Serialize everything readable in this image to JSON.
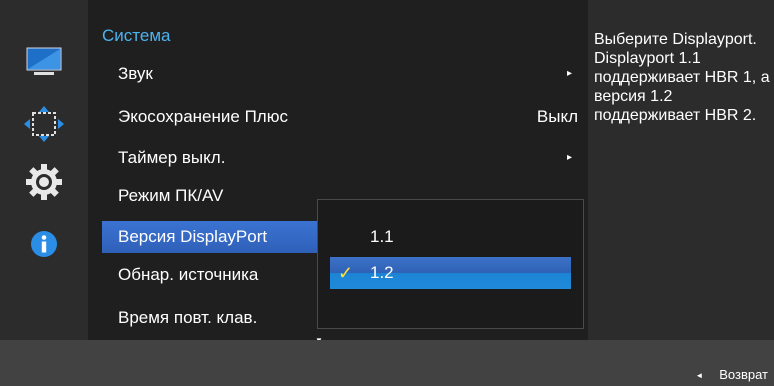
{
  "sidebar": {
    "icons": [
      "monitor-icon",
      "resize-arrows-icon",
      "gear-icon",
      "info-icon"
    ],
    "accent_color": "#2a8ee6"
  },
  "main": {
    "section_title": "Система",
    "items": [
      {
        "label": "Звук",
        "value": "",
        "arrow": "▸"
      },
      {
        "label": "Экосохранение Плюс",
        "value": "Выкл",
        "arrow": ""
      },
      {
        "label": "Таймер выкл.",
        "value": "",
        "arrow": "▸"
      },
      {
        "label": "Режим ПК/AV",
        "value": "",
        "arrow": ""
      },
      {
        "label": "Версия DisplayPort",
        "value": "",
        "arrow": ""
      },
      {
        "label": "Обнар. источника",
        "value": "",
        "arrow": ""
      },
      {
        "label": "Время повт. клав.",
        "value": "",
        "arrow": ""
      }
    ],
    "scroll_indicator": "▼"
  },
  "submenu": {
    "options": [
      {
        "label": "1.1",
        "checked": false
      },
      {
        "label": "1.2",
        "checked": true
      }
    ],
    "check_mark": "✓"
  },
  "help": {
    "text": "Выберите Displayport. Displayport 1.1 поддерживает HBR 1, а версия 1.2 поддерживает HBR 2."
  },
  "footer": {
    "back_icon": "◄",
    "back_label": "Возврат"
  }
}
